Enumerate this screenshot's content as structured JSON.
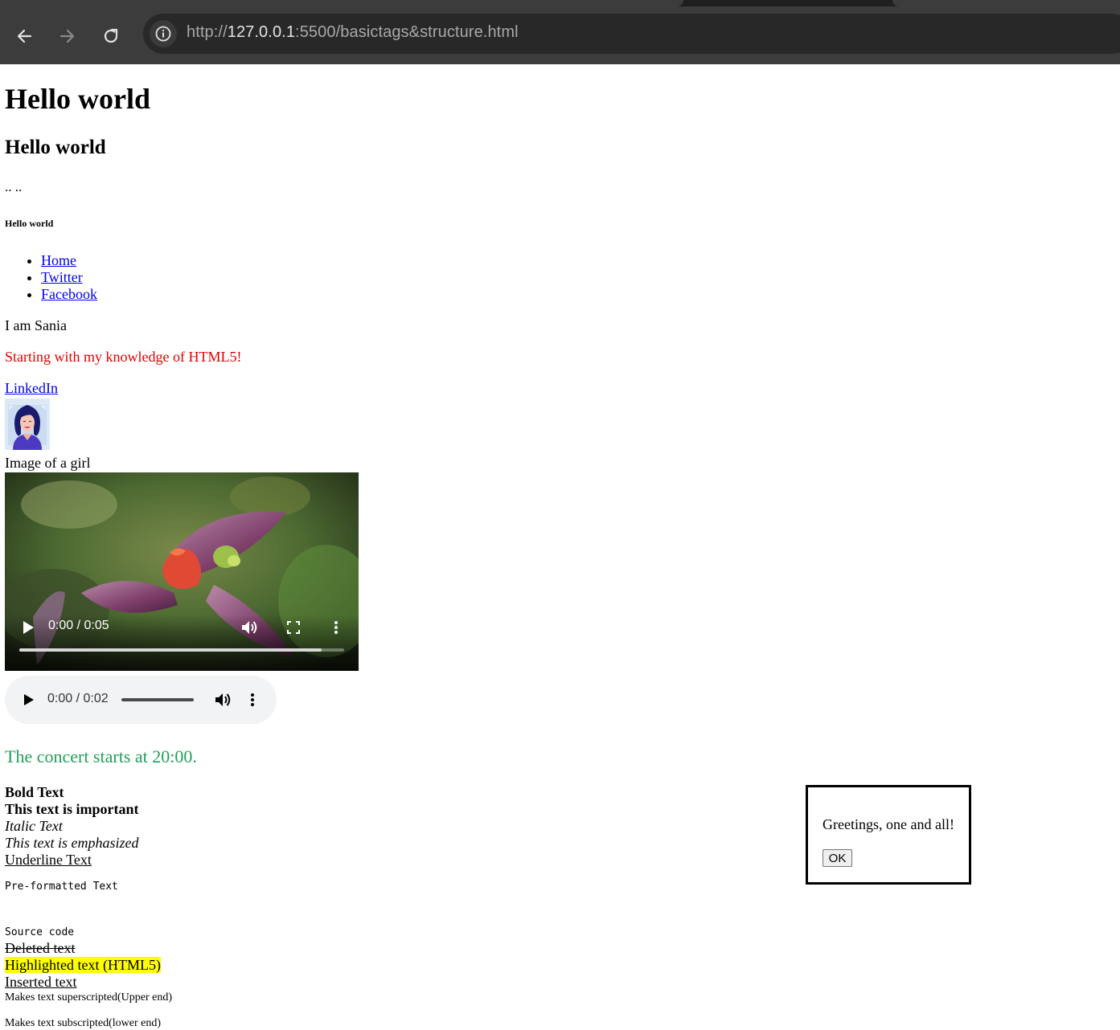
{
  "browser": {
    "url_protocol": "http://",
    "url_host": "127.0.0.1",
    "url_path": ":5500/basictags&structure.html",
    "back_icon": "arrow-left-icon",
    "forward_icon": "arrow-right-icon",
    "reload_icon": "reload-icon",
    "site_info_icon": "info-icon"
  },
  "page": {
    "h1": "Hello world",
    "h3": "Hello world",
    "dots": ".. ..",
    "h6": "Hello world",
    "nav": [
      {
        "label": "Home"
      },
      {
        "label": "Twitter"
      },
      {
        "label": "Facebook"
      }
    ],
    "intro": "I am Sania",
    "html5_line": "Starting with my knowledge of HTML5!",
    "html5_color": "#e00000",
    "linkedin": "LinkedIn",
    "image_caption": "Image of a girl",
    "video": {
      "time": "0:00 / 0:05",
      "progress_fraction": 0.93,
      "icons": [
        "play-icon",
        "volume-icon",
        "fullscreen-icon",
        "more-options-icon"
      ]
    },
    "audio": {
      "time": "0:00 / 0:02",
      "icons": [
        "play-icon",
        "volume-icon",
        "more-options-icon"
      ]
    },
    "concert": "The concert starts at 20:00.",
    "concert_color": "#21a05a",
    "bold": "Bold Text",
    "strong": "This text is important",
    "italic": "Italic Text",
    "em": "This text is emphasized",
    "underline": "Underline Text",
    "preformatted": "Pre-formatted Text",
    "source_code": "Source code",
    "deleted": "Deleted text",
    "highlighted": "Highlighted text (HTML5)",
    "inserted": "Inserted text",
    "superscript": "Makes text superscripted(Upper end)",
    "subscript": "Makes text subscripted(lower end)"
  },
  "dialog": {
    "message": "Greetings, one and all!",
    "ok_label": "OK"
  }
}
